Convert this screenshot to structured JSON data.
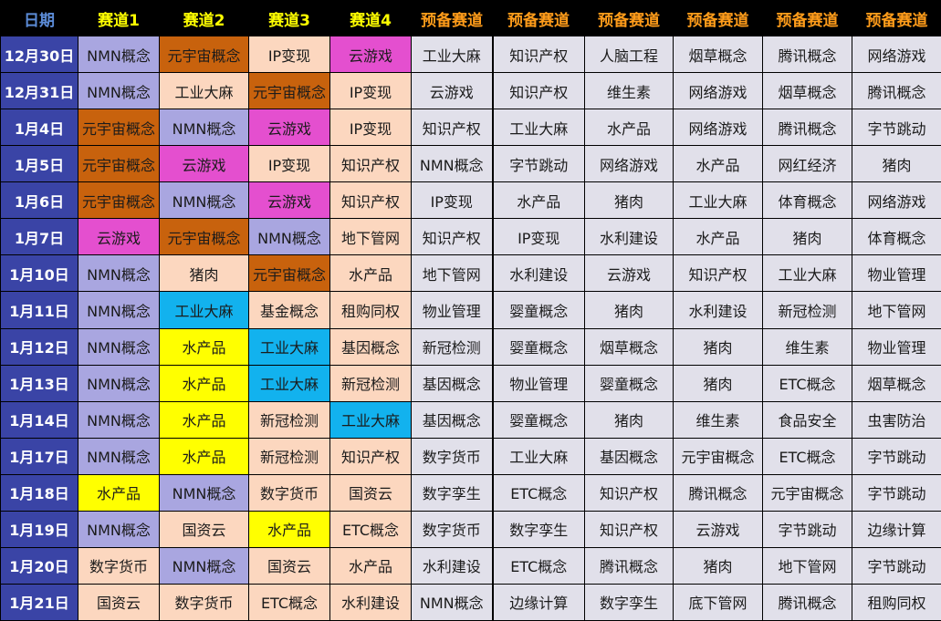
{
  "header": {
    "date": "日期",
    "tracks": [
      "赛道1",
      "赛道2",
      "赛道3",
      "赛道4"
    ],
    "backups": [
      "预备赛道",
      "预备赛道",
      "预备赛道",
      "预备赛道",
      "预备赛道",
      "预备赛道"
    ]
  },
  "colors": {
    "header_bg": "#000000",
    "header_date_text": "#5b8bd6",
    "header_track_text": "#ffff00",
    "header_backup_text": "#ff9c1a",
    "date_cell_bg": "#3a44a6",
    "backup_bg": "#e1e0ea",
    "lav": "#a9a6e0",
    "brown": "#c8620d",
    "peach": "#fcd7bf",
    "magenta": "#e44fcf",
    "yellow": "#ffff00",
    "cyan": "#12b2ee",
    "gray": "#e1e0ea"
  },
  "rows": [
    {
      "date": "12月30日",
      "tracks": [
        {
          "text": "NMN概念",
          "color": "lav"
        },
        {
          "text": "元宇宙概念",
          "color": "brown"
        },
        {
          "text": "IP变现",
          "color": "peach"
        },
        {
          "text": "云游戏",
          "color": "magenta"
        },
        {
          "text": "工业大麻",
          "color": "gray"
        }
      ],
      "backups": [
        "知识产权",
        "人脑工程",
        "烟草概念",
        "腾讯概念",
        "网络游戏"
      ]
    },
    {
      "date": "12月31日",
      "tracks": [
        {
          "text": "NMN概念",
          "color": "lav"
        },
        {
          "text": "工业大麻",
          "color": "peach"
        },
        {
          "text": "元宇宙概念",
          "color": "brown"
        },
        {
          "text": "IP变现",
          "color": "peach"
        },
        {
          "text": "云游戏",
          "color": "gray"
        }
      ],
      "backups": [
        "知识产权",
        "维生素",
        "网络游戏",
        "烟草概念",
        "腾讯概念"
      ]
    },
    {
      "date": "1月4日",
      "tracks": [
        {
          "text": "元宇宙概念",
          "color": "brown"
        },
        {
          "text": "NMN概念",
          "color": "lav"
        },
        {
          "text": "云游戏",
          "color": "magenta"
        },
        {
          "text": "IP变现",
          "color": "peach"
        },
        {
          "text": "知识产权",
          "color": "gray"
        }
      ],
      "backups": [
        "工业大麻",
        "水产品",
        "网络游戏",
        "腾讯概念",
        "字节跳动"
      ]
    },
    {
      "date": "1月5日",
      "tracks": [
        {
          "text": "元宇宙概念",
          "color": "brown"
        },
        {
          "text": "云游戏",
          "color": "magenta"
        },
        {
          "text": "IP变现",
          "color": "peach"
        },
        {
          "text": "知识产权",
          "color": "peach"
        },
        {
          "text": "NMN概念",
          "color": "gray"
        }
      ],
      "backups": [
        "字节跳动",
        "网络游戏",
        "水产品",
        "网红经济",
        "猪肉"
      ]
    },
    {
      "date": "1月6日",
      "tracks": [
        {
          "text": "元宇宙概念",
          "color": "brown"
        },
        {
          "text": "NMN概念",
          "color": "lav"
        },
        {
          "text": "云游戏",
          "color": "magenta"
        },
        {
          "text": "知识产权",
          "color": "peach"
        },
        {
          "text": "IP变现",
          "color": "gray"
        }
      ],
      "backups": [
        "水产品",
        "猪肉",
        "工业大麻",
        "体育概念",
        "网络游戏"
      ]
    },
    {
      "date": "1月7日",
      "tracks": [
        {
          "text": "云游戏",
          "color": "magenta"
        },
        {
          "text": "元宇宙概念",
          "color": "brown"
        },
        {
          "text": "NMN概念",
          "color": "lav"
        },
        {
          "text": "地下管网",
          "color": "peach"
        },
        {
          "text": "知识产权",
          "color": "gray"
        }
      ],
      "backups": [
        "IP变现",
        "水利建设",
        "水产品",
        "猪肉",
        "体育概念"
      ]
    },
    {
      "date": "1月10日",
      "tracks": [
        {
          "text": "NMN概念",
          "color": "lav"
        },
        {
          "text": "猪肉",
          "color": "peach"
        },
        {
          "text": "元宇宙概念",
          "color": "brown"
        },
        {
          "text": "水产品",
          "color": "peach"
        },
        {
          "text": "地下管网",
          "color": "gray"
        }
      ],
      "backups": [
        "水利建设",
        "云游戏",
        "知识产权",
        "工业大麻",
        "物业管理"
      ]
    },
    {
      "date": "1月11日",
      "tracks": [
        {
          "text": "NMN概念",
          "color": "lav"
        },
        {
          "text": "工业大麻",
          "color": "cyan"
        },
        {
          "text": "基金概念",
          "color": "peach"
        },
        {
          "text": "租购同权",
          "color": "peach"
        },
        {
          "text": "物业管理",
          "color": "gray"
        }
      ],
      "backups": [
        "婴童概念",
        "猪肉",
        "水利建设",
        "新冠检测",
        "地下管网"
      ]
    },
    {
      "date": "1月12日",
      "tracks": [
        {
          "text": "NMN概念",
          "color": "lav"
        },
        {
          "text": "水产品",
          "color": "yellow"
        },
        {
          "text": "工业大麻",
          "color": "cyan"
        },
        {
          "text": "基因概念",
          "color": "peach"
        },
        {
          "text": "新冠检测",
          "color": "gray"
        }
      ],
      "backups": [
        "婴童概念",
        "烟草概念",
        "猪肉",
        "维生素",
        "物业管理"
      ]
    },
    {
      "date": "1月13日",
      "tracks": [
        {
          "text": "NMN概念",
          "color": "lav"
        },
        {
          "text": "水产品",
          "color": "yellow"
        },
        {
          "text": "工业大麻",
          "color": "cyan"
        },
        {
          "text": "新冠检测",
          "color": "peach"
        },
        {
          "text": "基因概念",
          "color": "gray"
        }
      ],
      "backups": [
        "物业管理",
        "婴童概念",
        "猪肉",
        "ETC概念",
        "烟草概念"
      ]
    },
    {
      "date": "1月14日",
      "tracks": [
        {
          "text": "NMN概念",
          "color": "lav"
        },
        {
          "text": "水产品",
          "color": "yellow"
        },
        {
          "text": "新冠检测",
          "color": "peach"
        },
        {
          "text": "工业大麻",
          "color": "cyan"
        },
        {
          "text": "基因概念",
          "color": "gray"
        }
      ],
      "backups": [
        "婴童概念",
        "猪肉",
        "维生素",
        "食品安全",
        "虫害防治"
      ]
    },
    {
      "date": "1月17日",
      "tracks": [
        {
          "text": "NMN概念",
          "color": "lav"
        },
        {
          "text": "水产品",
          "color": "yellow"
        },
        {
          "text": "新冠检测",
          "color": "peach"
        },
        {
          "text": "知识产权",
          "color": "peach"
        },
        {
          "text": "数字货币",
          "color": "gray"
        }
      ],
      "backups": [
        "工业大麻",
        "基因概念",
        "元宇宙概念",
        "ETC概念",
        "字节跳动"
      ]
    },
    {
      "date": "1月18日",
      "tracks": [
        {
          "text": "水产品",
          "color": "yellow"
        },
        {
          "text": "NMN概念",
          "color": "lav"
        },
        {
          "text": "数字货币",
          "color": "peach"
        },
        {
          "text": "国资云",
          "color": "peach"
        },
        {
          "text": "数字孪生",
          "color": "gray"
        }
      ],
      "backups": [
        "ETC概念",
        "知识产权",
        "腾讯概念",
        "元宇宙概念",
        "字节跳动"
      ]
    },
    {
      "date": "1月19日",
      "tracks": [
        {
          "text": "NMN概念",
          "color": "lav"
        },
        {
          "text": "国资云",
          "color": "peach"
        },
        {
          "text": "水产品",
          "color": "yellow"
        },
        {
          "text": "ETC概念",
          "color": "peach"
        },
        {
          "text": "数字货币",
          "color": "gray"
        }
      ],
      "backups": [
        "数字孪生",
        "知识产权",
        "云游戏",
        "字节跳动",
        "边缘计算"
      ]
    },
    {
      "date": "1月20日",
      "tracks": [
        {
          "text": "数字货币",
          "color": "peach"
        },
        {
          "text": "NMN概念",
          "color": "lav"
        },
        {
          "text": "国资云",
          "color": "peach"
        },
        {
          "text": "水产品",
          "color": "peach"
        },
        {
          "text": "水利建设",
          "color": "gray"
        }
      ],
      "backups": [
        "ETC概念",
        "腾讯概念",
        "猪肉",
        "地下管网",
        "字节跳动"
      ]
    },
    {
      "date": "1月21日",
      "tracks": [
        {
          "text": "国资云",
          "color": "peach"
        },
        {
          "text": "数字货币",
          "color": "peach"
        },
        {
          "text": "ETC概念",
          "color": "peach"
        },
        {
          "text": "水利建设",
          "color": "peach"
        },
        {
          "text": "NMN概念",
          "color": "gray"
        }
      ],
      "backups": [
        "边缘计算",
        "数字孪生",
        "底下管网",
        "腾讯概念",
        "租购同权"
      ]
    }
  ]
}
